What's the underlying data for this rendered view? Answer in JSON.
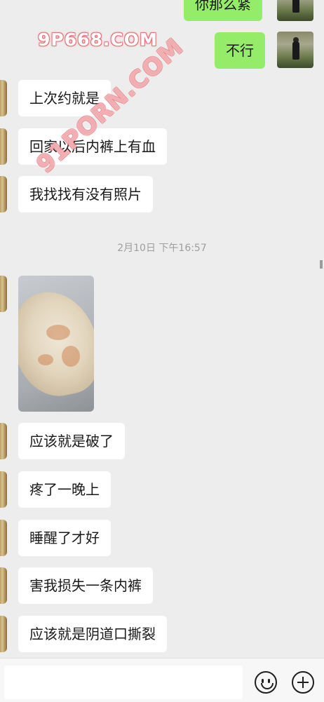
{
  "watermarks": {
    "top": "9P668.COM",
    "diagonal": "91PORN.COM"
  },
  "chat": {
    "sent": [
      {
        "text": "你那么紧"
      },
      {
        "text": "不行"
      }
    ],
    "received_before": [
      {
        "text": "上次约就是"
      },
      {
        "text": "回家以后内裤上有血"
      },
      {
        "text": "我找找有没有照片"
      }
    ],
    "timestamp": "2月10日 下午16:57",
    "received_after": [
      {
        "text": "应该就是破了"
      },
      {
        "text": "疼了一晚上"
      },
      {
        "text": "睡醒了才好"
      },
      {
        "text": "害我损失一条内裤"
      },
      {
        "text": "应该就是阴道口撕裂"
      }
    ]
  },
  "input_bar": {
    "emoji_icon": "smiley-face-icon",
    "plus_icon": "plus-circle-icon"
  },
  "colors": {
    "sent_bubble": "#95ec69",
    "received_bubble": "#ffffff",
    "background": "#ededed"
  }
}
